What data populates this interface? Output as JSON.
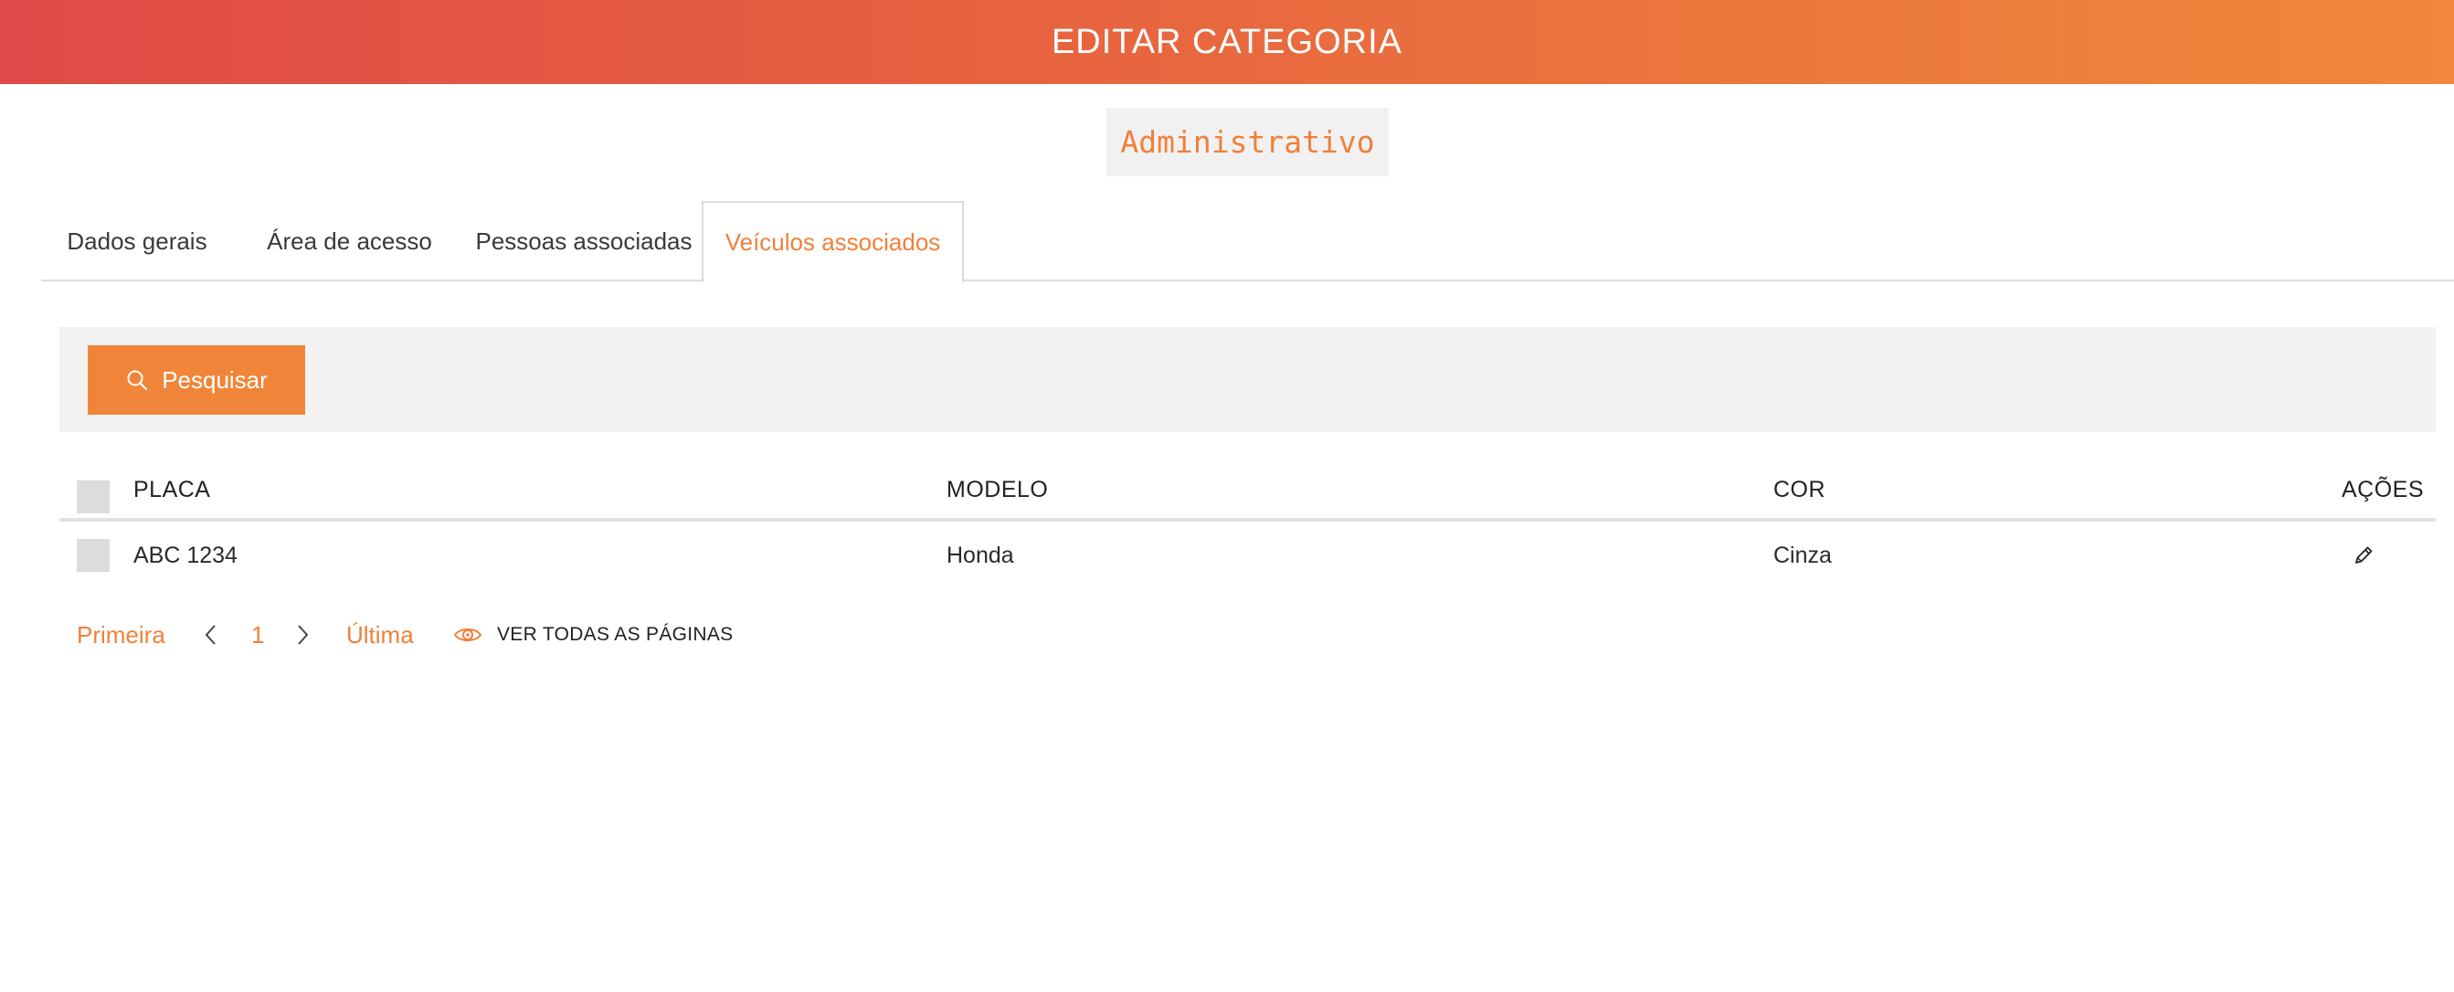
{
  "header": {
    "title": "EDITAR CATEGORIA"
  },
  "category": {
    "name": "Administrativo"
  },
  "tabs": [
    {
      "label": "Dados gerais",
      "active": false
    },
    {
      "label": "Área de acesso",
      "active": false
    },
    {
      "label": "Pessoas associadas",
      "active": false
    },
    {
      "label": "Veículos associados",
      "active": true
    }
  ],
  "toolbar": {
    "search_label": "Pesquisar",
    "search_icon": "search-icon"
  },
  "table": {
    "columns": [
      "PLACA",
      "MODELO",
      "COR",
      "AÇÕES"
    ],
    "rows": [
      {
        "placa": "ABC 1234",
        "modelo": "Honda",
        "cor": "Cinza",
        "action_icon": "pencil-icon"
      }
    ]
  },
  "pagination": {
    "first": "Primeira",
    "current_page": "1",
    "last": "Última",
    "view_all": "VER TODAS AS PÁGINAS",
    "view_all_icon": "eye-icon"
  },
  "colors": {
    "accent": "#f0803a",
    "header_gradient_start": "#e04a48",
    "header_gradient_end": "#f0873a",
    "toolbar_bg": "#f2f2f2",
    "badge_bg": "#f1f1f1"
  }
}
